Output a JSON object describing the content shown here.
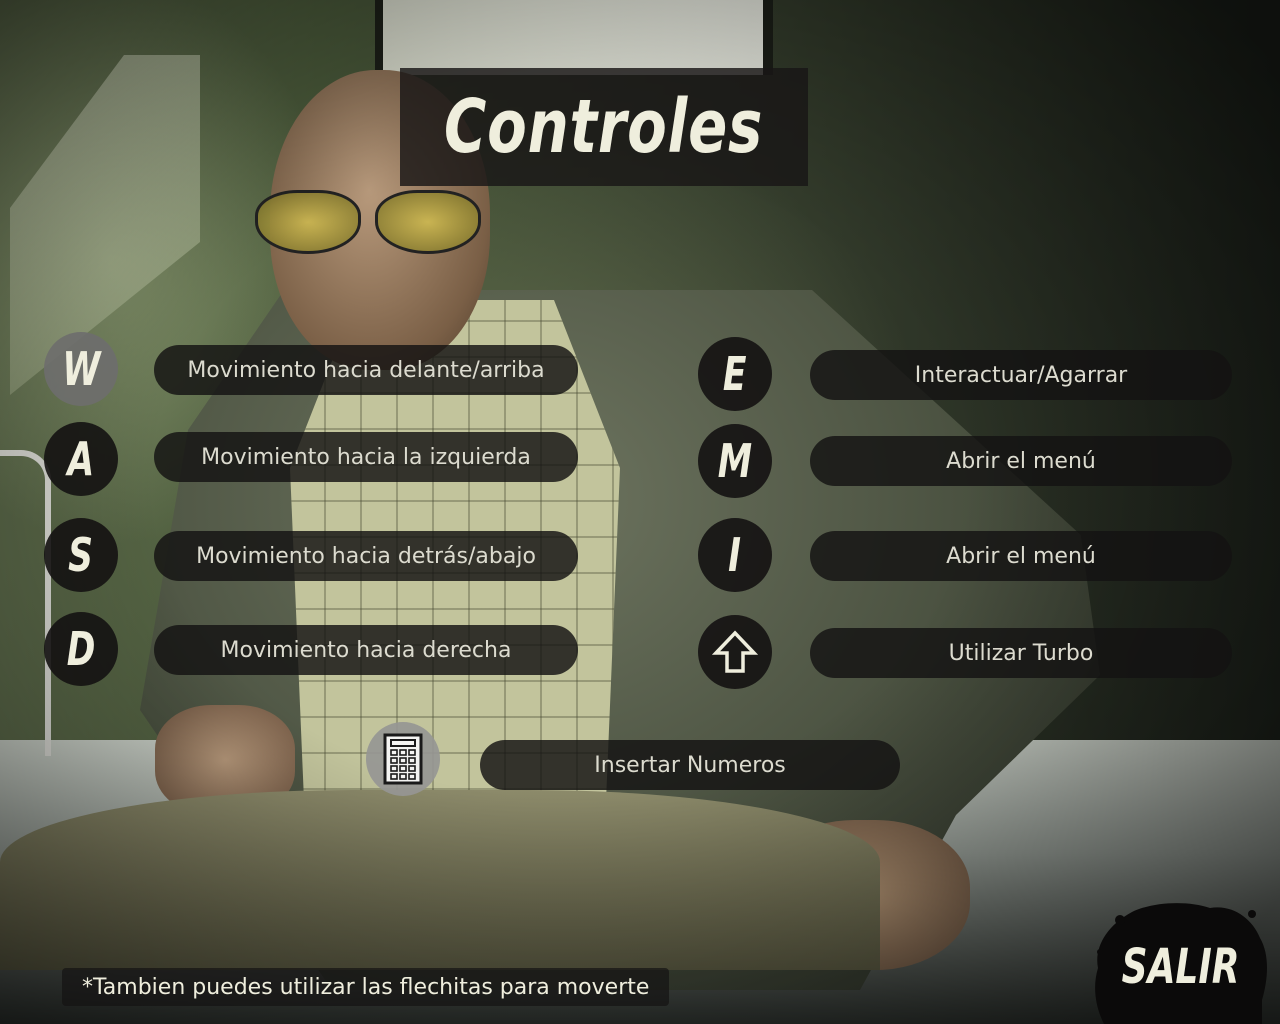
{
  "title": "Controles",
  "left_controls": [
    {
      "key": "W",
      "action": "Movimiento hacia delante/arriba"
    },
    {
      "key": "A",
      "action": "Movimiento hacia la izquierda"
    },
    {
      "key": "S",
      "action": "Movimiento hacia detrás/abajo"
    },
    {
      "key": "D",
      "action": "Movimiento hacia derecha"
    }
  ],
  "right_controls": [
    {
      "key": "E",
      "action": "Interactuar/Agarrar"
    },
    {
      "key": "M",
      "action": "Abrir el menú"
    },
    {
      "key": "I",
      "action": "Abrir el menú"
    },
    {
      "key_icon": "shift-arrow-icon",
      "action": "Utilizar Turbo"
    }
  ],
  "numbers_control": {
    "key_icon": "keypad-icon",
    "action": "Insertar Numeros"
  },
  "footnote": "*Tambien puedes utilizar las flechitas para moverte",
  "exit_label": "SALIR"
}
